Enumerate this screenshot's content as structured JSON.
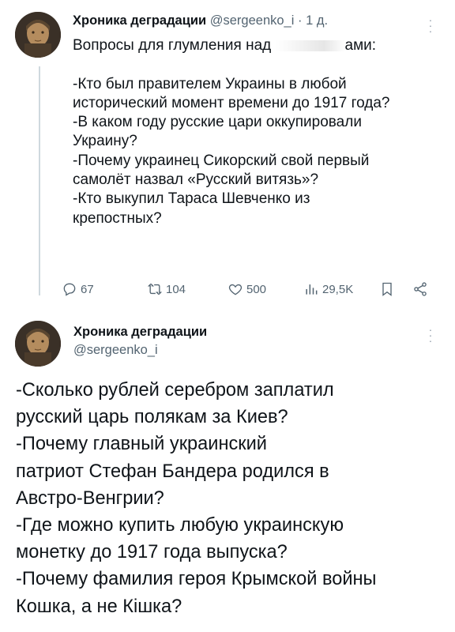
{
  "tweet1": {
    "author_name": "Хроника деградации",
    "author_handle": "@sergeenko_i",
    "time": "· 1 д.",
    "lines": [
      "Вопросы для глумления над",
      "ами:",
      "",
      "-Кто был правителем Украины в любой",
      "исторический момент времени до 1917 года?",
      "-В каком году русские цари оккупировали",
      "Украину?",
      "-Почему украинец Сикорский свой первый",
      "самолёт назвал «Русский витязь»?",
      "-Кто выкупил Тараса Шевченко из",
      "крепостных?"
    ],
    "actions": {
      "replies": "67",
      "reposts": "104",
      "likes": "500",
      "views": "29,5K"
    }
  },
  "tweet2": {
    "author_name": "Хроника деградации",
    "author_handle": "@sergeenko_i",
    "lines": [
      "-Сколько рублей серебром заплатил",
      "русский царь полякам за Киев?",
      "-Почему главный украинский",
      "патриот Стефан Бандера родился в",
      "Австро-Венгрии?",
      "-Где можно купить любую украинскую",
      "монетку до 1917 года выпуска?",
      "-Почему фамилия героя Крымской войны",
      "Кошка, а не Кішка?"
    ]
  },
  "icons": {
    "reply": "reply-icon",
    "repost": "repost-icon",
    "like": "heart-icon",
    "views": "views-icon",
    "bookmark": "bookmark-icon",
    "share": "share-icon",
    "more": "more-icon"
  },
  "colors": {
    "text": "#0f1419",
    "muted": "#536471",
    "line": "#cfd9de"
  }
}
